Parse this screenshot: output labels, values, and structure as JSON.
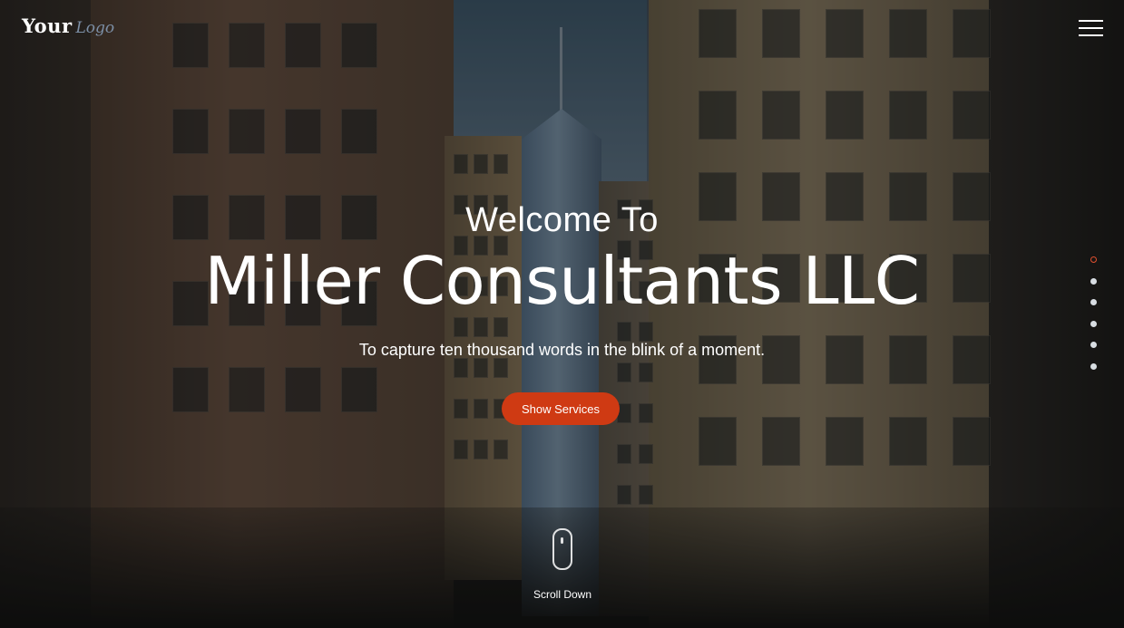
{
  "header": {
    "logo_main": "Your",
    "logo_script": "Logo",
    "menu_icon": "hamburger-menu-icon"
  },
  "hero": {
    "welcome": "Welcome To",
    "headline": "Miller Consultants LLC",
    "tagline": "To capture ten thousand words in the blink of a moment.",
    "cta_label": "Show Services",
    "scroll_label": "Scroll Down",
    "scroll_icon": "mouse-scroll-icon"
  },
  "section_nav": {
    "count": 6,
    "active_index": 0
  },
  "colors": {
    "accent": "#cf3a13",
    "active_dot": "#e1502f",
    "logo_script": "#7c8fa6"
  }
}
